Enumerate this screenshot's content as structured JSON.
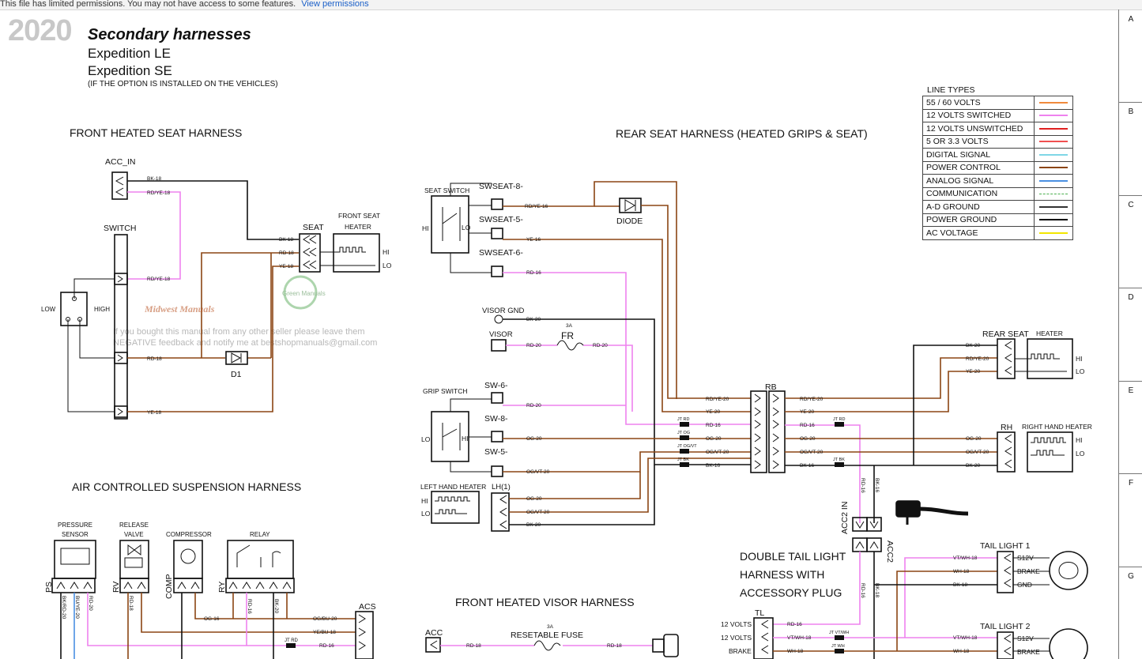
{
  "top_notice": {
    "text": "This file has limited permissions. You may not have access to some features.",
    "link": "View permissions"
  },
  "header": {
    "year": "2020",
    "title": "Secondary harnesses",
    "model1": "Expedition LE",
    "model2": "Expedition SE",
    "note": "(IF THE OPTION IS INSTALLED ON THE VEHICLES)"
  },
  "sections": {
    "front_heated_seat": "FRONT HEATED SEAT HARNESS",
    "rear_seat": "REAR SEAT HARNESS (HEATED GRIPS & SEAT)",
    "air_suspension": "AIR CONTROLLED SUSPENSION HARNESS",
    "front_visor": "FRONT HEATED VISOR HARNESS",
    "double_tail_line1": "DOUBLE TAIL LIGHT",
    "double_tail_line2": "HARNESS WITH",
    "double_tail_line3": "ACCESSORY PLUG"
  },
  "line_types": {
    "title": "LINE TYPES",
    "rows": [
      {
        "label": "55 / 60 VOLTS",
        "color": "#f08a3c"
      },
      {
        "label": "12 VOLTS SWITCHED",
        "color": "#ee82ee"
      },
      {
        "label": "12 VOLTS UNSWITCHED",
        "color": "#e02020"
      },
      {
        "label": "5 OR 3.3 VOLTS",
        "color": "#f05050"
      },
      {
        "label": "DIGITAL SIGNAL",
        "color": "#7fd6e6"
      },
      {
        "label": "POWER CONTROL",
        "color": "#8b4513"
      },
      {
        "label": "ANALOG SIGNAL",
        "color": "#4a90e2"
      },
      {
        "label": "COMMUNICATION",
        "color": "#4caf50"
      },
      {
        "label": "A-D GROUND",
        "color": "#333333"
      },
      {
        "label": "POWER GROUND",
        "color": "#000000"
      },
      {
        "label": "AC VOLTAGE",
        "color": "#f2e600"
      }
    ]
  },
  "grid_rows": [
    "A",
    "B",
    "C",
    "D",
    "E",
    "F",
    "G"
  ],
  "components": {
    "acc_in": "ACC_IN",
    "switch": "SWITCH",
    "low": "LOW",
    "high": "HIGH",
    "seat": "SEAT",
    "front_seat_heater_1": "FRONT SEAT",
    "front_seat_heater_2": "HEATER",
    "hi": "HI",
    "lo": "LO",
    "d1": "D1",
    "seat_switch": "SEAT SWITCH",
    "swseat8": "SWSEAT-8-",
    "swseat5": "SWSEAT-5-",
    "swseat6": "SWSEAT-6-",
    "diode": "DIODE",
    "visor_gnd": "VISOR GND",
    "visor": "VISOR",
    "fr": "FR",
    "fuse_3a": "3A",
    "grip_switch": "GRIP SWITCH",
    "sw6": "SW-6-",
    "sw8": "SW-8-",
    "sw5": "SW-5-",
    "left_hand_heater": "LEFT HAND HEATER",
    "lh1": "LH(1)",
    "rb": "RB",
    "rear_seat": "REAR SEAT",
    "heater": "HEATER",
    "rh": "RH",
    "right_hand_heater": "RIGHT HAND HEATER",
    "acc2_in": "ACC2 IN",
    "acc2": "ACC2",
    "tail_light_1": "TAIL LIGHT 1",
    "tail_light_2": "TAIL LIGHT 2",
    "s12v": "S12V",
    "brake": "BRAKE",
    "gnd": "GND",
    "tl": "TL",
    "v12_1": "12 VOLTS",
    "v12_2": "12 VOLTS",
    "brake_tl": "BRAKE",
    "pressure_sensor_1": "PRESSURE",
    "pressure_sensor_2": "SENSOR",
    "release_valve_1": "RELEASE",
    "release_valve_2": "VALVE",
    "compressor": "COMPRESSOR",
    "relay": "RELAY",
    "ps": "PS",
    "rv": "RV",
    "comp": "COMP",
    "ry": "RY",
    "acs": "ACS",
    "acc": "ACC",
    "resetable_fuse": "RESETABLE FUSE"
  },
  "wires": {
    "bk18": "BK-18",
    "rdye18": "RD/YE-18",
    "rd18": "RD-18",
    "ye18": "YE-18",
    "rdye16": "RD/YE-16",
    "ye16": "YE-16",
    "rd16": "RD-16",
    "bk20": "BK-20",
    "rd20": "RD-20",
    "rdye20": "RD/YE-20",
    "ye20": "YE-20",
    "og20": "OG-20",
    "ogvt20": "OG/VT-20",
    "bk16": "BK-16",
    "vtwh18": "VT/WH-18",
    "wh18": "WH-18",
    "ogbu20": "OG/BU-20",
    "yebu18": "YE/BU-18",
    "og16": "OG-16",
    "bkrd20": "BK/RD-20",
    "buye20": "BU/YE-20",
    "rd20b": "RD-20",
    "jtrd": "JT RD",
    "jtog": "JT OG",
    "jtogvt": "JT OG/VT",
    "jtbk": "JT BK",
    "jtvtwh": "JT VT/WH",
    "jtwh": "JT WH"
  },
  "watermark": {
    "line1": "If you bought this manual from any other seller please leave them",
    "line2": "NEGATIVE feedback and notify me at bestshopmanuals@gmail.com",
    "brand": "Midwest Manuals",
    "green": "Green Manuals"
  }
}
